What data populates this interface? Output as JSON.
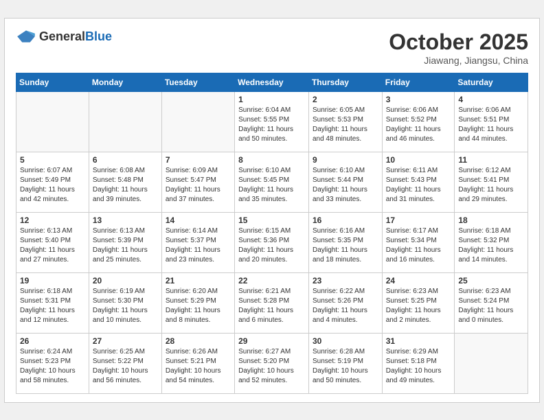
{
  "header": {
    "logo_general": "General",
    "logo_blue": "Blue",
    "month": "October 2025",
    "location": "Jiawang, Jiangsu, China"
  },
  "weekdays": [
    "Sunday",
    "Monday",
    "Tuesday",
    "Wednesday",
    "Thursday",
    "Friday",
    "Saturday"
  ],
  "weeks": [
    [
      {
        "day": "",
        "info": ""
      },
      {
        "day": "",
        "info": ""
      },
      {
        "day": "",
        "info": ""
      },
      {
        "day": "1",
        "info": "Sunrise: 6:04 AM\nSunset: 5:55 PM\nDaylight: 11 hours\nand 50 minutes."
      },
      {
        "day": "2",
        "info": "Sunrise: 6:05 AM\nSunset: 5:53 PM\nDaylight: 11 hours\nand 48 minutes."
      },
      {
        "day": "3",
        "info": "Sunrise: 6:06 AM\nSunset: 5:52 PM\nDaylight: 11 hours\nand 46 minutes."
      },
      {
        "day": "4",
        "info": "Sunrise: 6:06 AM\nSunset: 5:51 PM\nDaylight: 11 hours\nand 44 minutes."
      }
    ],
    [
      {
        "day": "5",
        "info": "Sunrise: 6:07 AM\nSunset: 5:49 PM\nDaylight: 11 hours\nand 42 minutes."
      },
      {
        "day": "6",
        "info": "Sunrise: 6:08 AM\nSunset: 5:48 PM\nDaylight: 11 hours\nand 39 minutes."
      },
      {
        "day": "7",
        "info": "Sunrise: 6:09 AM\nSunset: 5:47 PM\nDaylight: 11 hours\nand 37 minutes."
      },
      {
        "day": "8",
        "info": "Sunrise: 6:10 AM\nSunset: 5:45 PM\nDaylight: 11 hours\nand 35 minutes."
      },
      {
        "day": "9",
        "info": "Sunrise: 6:10 AM\nSunset: 5:44 PM\nDaylight: 11 hours\nand 33 minutes."
      },
      {
        "day": "10",
        "info": "Sunrise: 6:11 AM\nSunset: 5:43 PM\nDaylight: 11 hours\nand 31 minutes."
      },
      {
        "day": "11",
        "info": "Sunrise: 6:12 AM\nSunset: 5:41 PM\nDaylight: 11 hours\nand 29 minutes."
      }
    ],
    [
      {
        "day": "12",
        "info": "Sunrise: 6:13 AM\nSunset: 5:40 PM\nDaylight: 11 hours\nand 27 minutes."
      },
      {
        "day": "13",
        "info": "Sunrise: 6:13 AM\nSunset: 5:39 PM\nDaylight: 11 hours\nand 25 minutes."
      },
      {
        "day": "14",
        "info": "Sunrise: 6:14 AM\nSunset: 5:37 PM\nDaylight: 11 hours\nand 23 minutes."
      },
      {
        "day": "15",
        "info": "Sunrise: 6:15 AM\nSunset: 5:36 PM\nDaylight: 11 hours\nand 20 minutes."
      },
      {
        "day": "16",
        "info": "Sunrise: 6:16 AM\nSunset: 5:35 PM\nDaylight: 11 hours\nand 18 minutes."
      },
      {
        "day": "17",
        "info": "Sunrise: 6:17 AM\nSunset: 5:34 PM\nDaylight: 11 hours\nand 16 minutes."
      },
      {
        "day": "18",
        "info": "Sunrise: 6:18 AM\nSunset: 5:32 PM\nDaylight: 11 hours\nand 14 minutes."
      }
    ],
    [
      {
        "day": "19",
        "info": "Sunrise: 6:18 AM\nSunset: 5:31 PM\nDaylight: 11 hours\nand 12 minutes."
      },
      {
        "day": "20",
        "info": "Sunrise: 6:19 AM\nSunset: 5:30 PM\nDaylight: 11 hours\nand 10 minutes."
      },
      {
        "day": "21",
        "info": "Sunrise: 6:20 AM\nSunset: 5:29 PM\nDaylight: 11 hours\nand 8 minutes."
      },
      {
        "day": "22",
        "info": "Sunrise: 6:21 AM\nSunset: 5:28 PM\nDaylight: 11 hours\nand 6 minutes."
      },
      {
        "day": "23",
        "info": "Sunrise: 6:22 AM\nSunset: 5:26 PM\nDaylight: 11 hours\nand 4 minutes."
      },
      {
        "day": "24",
        "info": "Sunrise: 6:23 AM\nSunset: 5:25 PM\nDaylight: 11 hours\nand 2 minutes."
      },
      {
        "day": "25",
        "info": "Sunrise: 6:23 AM\nSunset: 5:24 PM\nDaylight: 11 hours\nand 0 minutes."
      }
    ],
    [
      {
        "day": "26",
        "info": "Sunrise: 6:24 AM\nSunset: 5:23 PM\nDaylight: 10 hours\nand 58 minutes."
      },
      {
        "day": "27",
        "info": "Sunrise: 6:25 AM\nSunset: 5:22 PM\nDaylight: 10 hours\nand 56 minutes."
      },
      {
        "day": "28",
        "info": "Sunrise: 6:26 AM\nSunset: 5:21 PM\nDaylight: 10 hours\nand 54 minutes."
      },
      {
        "day": "29",
        "info": "Sunrise: 6:27 AM\nSunset: 5:20 PM\nDaylight: 10 hours\nand 52 minutes."
      },
      {
        "day": "30",
        "info": "Sunrise: 6:28 AM\nSunset: 5:19 PM\nDaylight: 10 hours\nand 50 minutes."
      },
      {
        "day": "31",
        "info": "Sunrise: 6:29 AM\nSunset: 5:18 PM\nDaylight: 10 hours\nand 49 minutes."
      },
      {
        "day": "",
        "info": ""
      }
    ]
  ]
}
